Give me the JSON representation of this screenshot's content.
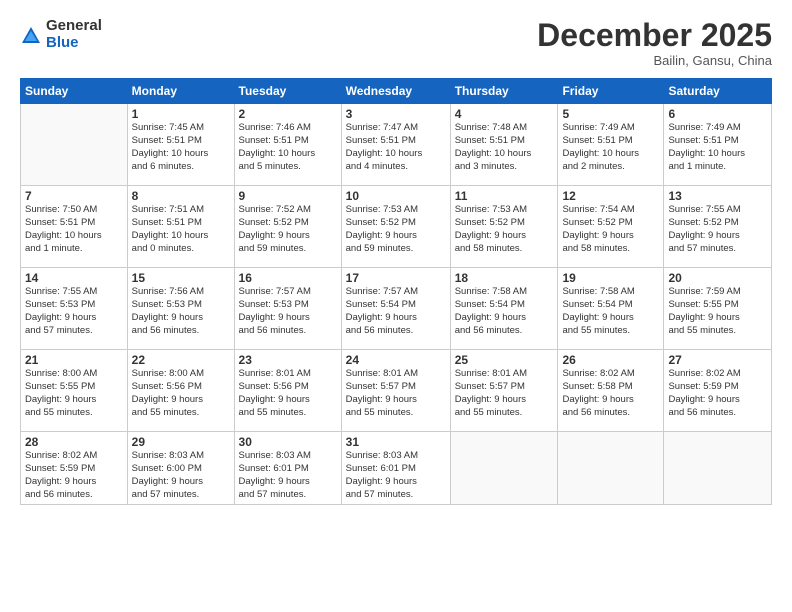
{
  "logo": {
    "general": "General",
    "blue": "Blue"
  },
  "title": "December 2025",
  "location": "Bailin, Gansu, China",
  "weekdays": [
    "Sunday",
    "Monday",
    "Tuesday",
    "Wednesday",
    "Thursday",
    "Friday",
    "Saturday"
  ],
  "weeks": [
    [
      {
        "num": "",
        "info": ""
      },
      {
        "num": "1",
        "info": "Sunrise: 7:45 AM\nSunset: 5:51 PM\nDaylight: 10 hours\nand 6 minutes."
      },
      {
        "num": "2",
        "info": "Sunrise: 7:46 AM\nSunset: 5:51 PM\nDaylight: 10 hours\nand 5 minutes."
      },
      {
        "num": "3",
        "info": "Sunrise: 7:47 AM\nSunset: 5:51 PM\nDaylight: 10 hours\nand 4 minutes."
      },
      {
        "num": "4",
        "info": "Sunrise: 7:48 AM\nSunset: 5:51 PM\nDaylight: 10 hours\nand 3 minutes."
      },
      {
        "num": "5",
        "info": "Sunrise: 7:49 AM\nSunset: 5:51 PM\nDaylight: 10 hours\nand 2 minutes."
      },
      {
        "num": "6",
        "info": "Sunrise: 7:49 AM\nSunset: 5:51 PM\nDaylight: 10 hours\nand 1 minute."
      }
    ],
    [
      {
        "num": "7",
        "info": "Sunrise: 7:50 AM\nSunset: 5:51 PM\nDaylight: 10 hours\nand 1 minute."
      },
      {
        "num": "8",
        "info": "Sunrise: 7:51 AM\nSunset: 5:51 PM\nDaylight: 10 hours\nand 0 minutes."
      },
      {
        "num": "9",
        "info": "Sunrise: 7:52 AM\nSunset: 5:52 PM\nDaylight: 9 hours\nand 59 minutes."
      },
      {
        "num": "10",
        "info": "Sunrise: 7:53 AM\nSunset: 5:52 PM\nDaylight: 9 hours\nand 59 minutes."
      },
      {
        "num": "11",
        "info": "Sunrise: 7:53 AM\nSunset: 5:52 PM\nDaylight: 9 hours\nand 58 minutes."
      },
      {
        "num": "12",
        "info": "Sunrise: 7:54 AM\nSunset: 5:52 PM\nDaylight: 9 hours\nand 58 minutes."
      },
      {
        "num": "13",
        "info": "Sunrise: 7:55 AM\nSunset: 5:52 PM\nDaylight: 9 hours\nand 57 minutes."
      }
    ],
    [
      {
        "num": "14",
        "info": "Sunrise: 7:55 AM\nSunset: 5:53 PM\nDaylight: 9 hours\nand 57 minutes."
      },
      {
        "num": "15",
        "info": "Sunrise: 7:56 AM\nSunset: 5:53 PM\nDaylight: 9 hours\nand 56 minutes."
      },
      {
        "num": "16",
        "info": "Sunrise: 7:57 AM\nSunset: 5:53 PM\nDaylight: 9 hours\nand 56 minutes."
      },
      {
        "num": "17",
        "info": "Sunrise: 7:57 AM\nSunset: 5:54 PM\nDaylight: 9 hours\nand 56 minutes."
      },
      {
        "num": "18",
        "info": "Sunrise: 7:58 AM\nSunset: 5:54 PM\nDaylight: 9 hours\nand 56 minutes."
      },
      {
        "num": "19",
        "info": "Sunrise: 7:58 AM\nSunset: 5:54 PM\nDaylight: 9 hours\nand 55 minutes."
      },
      {
        "num": "20",
        "info": "Sunrise: 7:59 AM\nSunset: 5:55 PM\nDaylight: 9 hours\nand 55 minutes."
      }
    ],
    [
      {
        "num": "21",
        "info": "Sunrise: 8:00 AM\nSunset: 5:55 PM\nDaylight: 9 hours\nand 55 minutes."
      },
      {
        "num": "22",
        "info": "Sunrise: 8:00 AM\nSunset: 5:56 PM\nDaylight: 9 hours\nand 55 minutes."
      },
      {
        "num": "23",
        "info": "Sunrise: 8:01 AM\nSunset: 5:56 PM\nDaylight: 9 hours\nand 55 minutes."
      },
      {
        "num": "24",
        "info": "Sunrise: 8:01 AM\nSunset: 5:57 PM\nDaylight: 9 hours\nand 55 minutes."
      },
      {
        "num": "25",
        "info": "Sunrise: 8:01 AM\nSunset: 5:57 PM\nDaylight: 9 hours\nand 55 minutes."
      },
      {
        "num": "26",
        "info": "Sunrise: 8:02 AM\nSunset: 5:58 PM\nDaylight: 9 hours\nand 56 minutes."
      },
      {
        "num": "27",
        "info": "Sunrise: 8:02 AM\nSunset: 5:59 PM\nDaylight: 9 hours\nand 56 minutes."
      }
    ],
    [
      {
        "num": "28",
        "info": "Sunrise: 8:02 AM\nSunset: 5:59 PM\nDaylight: 9 hours\nand 56 minutes."
      },
      {
        "num": "29",
        "info": "Sunrise: 8:03 AM\nSunset: 6:00 PM\nDaylight: 9 hours\nand 57 minutes."
      },
      {
        "num": "30",
        "info": "Sunrise: 8:03 AM\nSunset: 6:01 PM\nDaylight: 9 hours\nand 57 minutes."
      },
      {
        "num": "31",
        "info": "Sunrise: 8:03 AM\nSunset: 6:01 PM\nDaylight: 9 hours\nand 57 minutes."
      },
      {
        "num": "",
        "info": ""
      },
      {
        "num": "",
        "info": ""
      },
      {
        "num": "",
        "info": ""
      }
    ]
  ]
}
